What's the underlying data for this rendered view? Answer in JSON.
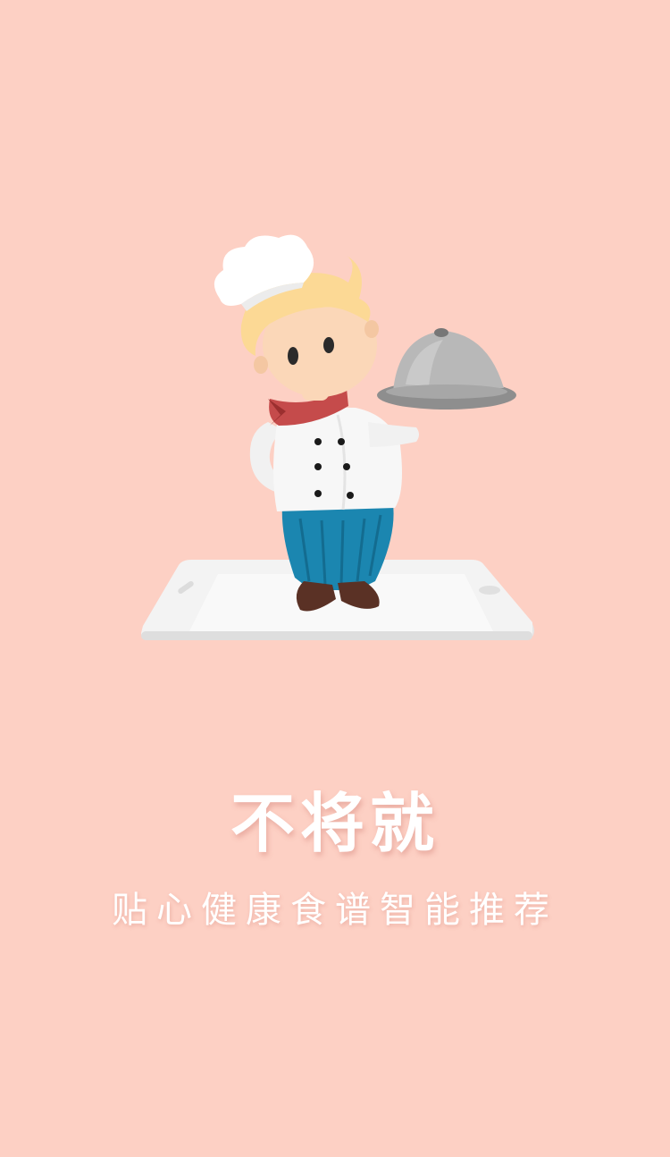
{
  "splash": {
    "headline": "不将就",
    "subtitle": "贴心健康食谱智能推荐"
  },
  "colors": {
    "background": "#fdd0c4",
    "text": "#ffffff"
  },
  "illustration": {
    "subject": "chef-with-cloche-on-phone"
  }
}
